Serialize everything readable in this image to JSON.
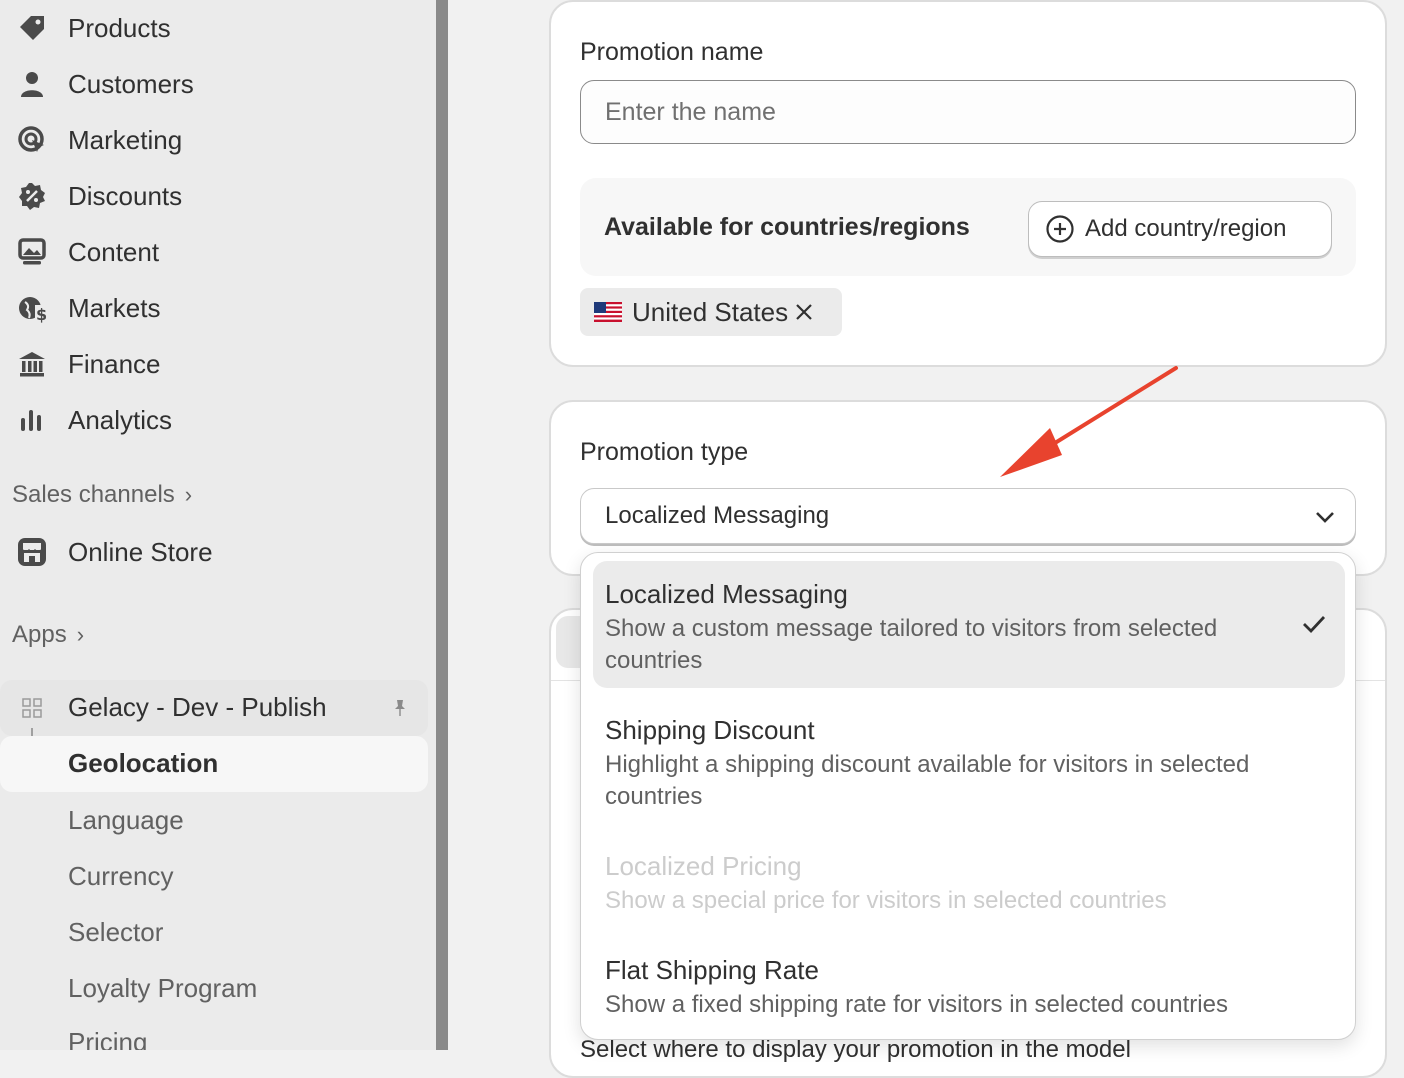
{
  "sidebar": {
    "nav": [
      {
        "label": "Products",
        "icon": "tag-icon"
      },
      {
        "label": "Customers",
        "icon": "person-icon"
      },
      {
        "label": "Marketing",
        "icon": "target-icon"
      },
      {
        "label": "Discounts",
        "icon": "discount-icon"
      },
      {
        "label": "Content",
        "icon": "image-icon"
      },
      {
        "label": "Markets",
        "icon": "globe-icon"
      },
      {
        "label": "Finance",
        "icon": "bank-icon"
      },
      {
        "label": "Analytics",
        "icon": "bar-chart-icon"
      }
    ],
    "sales_channels_label": "Sales channels",
    "online_store_label": "Online Store",
    "apps_label": "Apps",
    "app_name": "Gelacy - Dev - Publish",
    "app_subitems": [
      "Geolocation",
      "Language",
      "Currency",
      "Selector",
      "Loyalty Program",
      "Pricing"
    ]
  },
  "promotion": {
    "name_label": "Promotion name",
    "name_placeholder": "Enter the name",
    "name_value": "",
    "available_label": "Available for countries/regions",
    "add_country_label": "Add country/region",
    "selected_country": "United States"
  },
  "promotion_type": {
    "label": "Promotion type",
    "selected": "Localized Messaging",
    "options": [
      {
        "title": "Localized Messaging",
        "description": "Show a custom message tailored to visitors from selected countries",
        "selected": true,
        "disabled": false
      },
      {
        "title": "Shipping Discount",
        "description": "Highlight a shipping discount available for visitors in selected countries",
        "selected": false,
        "disabled": false
      },
      {
        "title": "Localized Pricing",
        "description": "Show a special price for visitors in selected countries",
        "selected": false,
        "disabled": true
      },
      {
        "title": "Flat Shipping Rate",
        "description": "Show a fixed shipping rate for visitors in selected countries",
        "selected": false,
        "disabled": false
      }
    ]
  },
  "partial_text": "Select where to display your promotion in the model",
  "colors": {
    "annotation_arrow": "#e8432e",
    "sidebar_bg": "#ebebeb",
    "page_bg": "#f1f1f1"
  }
}
